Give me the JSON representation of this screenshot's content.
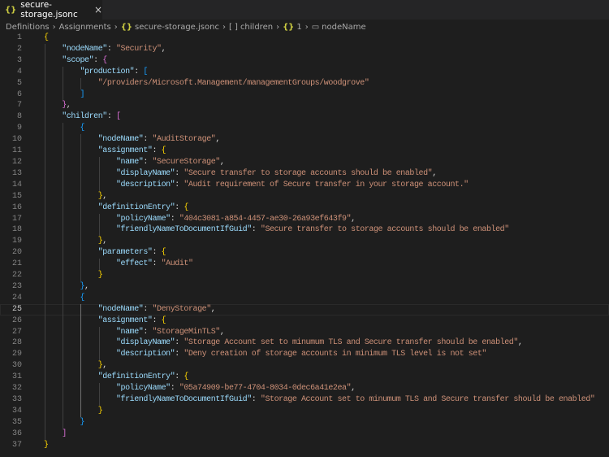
{
  "tab": {
    "icon": "{}",
    "title": "secure-storage.jsonc",
    "close": "×"
  },
  "breadcrumb": [
    {
      "label": "Definitions",
      "icon": ""
    },
    {
      "label": "Assignments",
      "icon": ""
    },
    {
      "label": "secure-storage.jsonc",
      "icon": "{}"
    },
    {
      "label": "children",
      "icon": "[ ]"
    },
    {
      "label": "1",
      "icon": "{}"
    },
    {
      "label": "nodeName",
      "icon": "▭"
    }
  ],
  "editor": {
    "current_line": 25,
    "lines": [
      {
        "n": "1",
        "i": 0,
        "t": [
          [
            "b1",
            "{"
          ]
        ]
      },
      {
        "n": "2",
        "i": 1,
        "t": [
          [
            "k",
            "\"nodeName\""
          ],
          [
            "p",
            ": "
          ],
          [
            "s",
            "\"Security\""
          ],
          [
            "p",
            ","
          ]
        ]
      },
      {
        "n": "3",
        "i": 1,
        "t": [
          [
            "k",
            "\"scope\""
          ],
          [
            "p",
            ": "
          ],
          [
            "b2",
            "{"
          ]
        ]
      },
      {
        "n": "4",
        "i": 2,
        "t": [
          [
            "k",
            "\"production\""
          ],
          [
            "p",
            ": "
          ],
          [
            "b3",
            "["
          ]
        ]
      },
      {
        "n": "5",
        "i": 3,
        "t": [
          [
            "s",
            "\"/providers/Microsoft.Management/managementGroups/woodgrove\""
          ]
        ]
      },
      {
        "n": "6",
        "i": 2,
        "t": [
          [
            "b3",
            "]"
          ]
        ]
      },
      {
        "n": "7",
        "i": 1,
        "t": [
          [
            "b2",
            "}"
          ],
          [
            "p",
            ","
          ]
        ]
      },
      {
        "n": "8",
        "i": 1,
        "t": [
          [
            "k",
            "\"children\""
          ],
          [
            "p",
            ": "
          ],
          [
            "b2",
            "["
          ]
        ]
      },
      {
        "n": "9",
        "i": 2,
        "t": [
          [
            "b3",
            "{"
          ]
        ]
      },
      {
        "n": "10",
        "i": 3,
        "t": [
          [
            "k",
            "\"nodeName\""
          ],
          [
            "p",
            ": "
          ],
          [
            "s",
            "\"AuditStorage\""
          ],
          [
            "p",
            ","
          ]
        ]
      },
      {
        "n": "11",
        "i": 3,
        "t": [
          [
            "k",
            "\"assignment\""
          ],
          [
            "p",
            ": "
          ],
          [
            "b1",
            "{"
          ]
        ]
      },
      {
        "n": "12",
        "i": 4,
        "t": [
          [
            "k",
            "\"name\""
          ],
          [
            "p",
            ": "
          ],
          [
            "s",
            "\"SecureStorage\""
          ],
          [
            "p",
            ","
          ]
        ]
      },
      {
        "n": "13",
        "i": 4,
        "t": [
          [
            "k",
            "\"displayName\""
          ],
          [
            "p",
            ": "
          ],
          [
            "s",
            "\"Secure transfer to storage accounts should be enabled\""
          ],
          [
            "p",
            ","
          ]
        ]
      },
      {
        "n": "14",
        "i": 4,
        "t": [
          [
            "k",
            "\"description\""
          ],
          [
            "p",
            ": "
          ],
          [
            "s",
            "\"Audit requirement of Secure transfer in your storage account.\""
          ]
        ]
      },
      {
        "n": "15",
        "i": 3,
        "t": [
          [
            "b1",
            "}"
          ],
          [
            "p",
            ","
          ]
        ]
      },
      {
        "n": "16",
        "i": 3,
        "t": [
          [
            "k",
            "\"definitionEntry\""
          ],
          [
            "p",
            ": "
          ],
          [
            "b1",
            "{"
          ]
        ]
      },
      {
        "n": "17",
        "i": 4,
        "t": [
          [
            "k",
            "\"policyName\""
          ],
          [
            "p",
            ": "
          ],
          [
            "s",
            "\"404c3081-a854-4457-ae30-26a93ef643f9\""
          ],
          [
            "p",
            ","
          ]
        ]
      },
      {
        "n": "18",
        "i": 4,
        "t": [
          [
            "k",
            "\"friendlyNameToDocumentIfGuid\""
          ],
          [
            "p",
            ": "
          ],
          [
            "s",
            "\"Secure transfer to storage accounts should be enabled\""
          ]
        ]
      },
      {
        "n": "19",
        "i": 3,
        "t": [
          [
            "b1",
            "}"
          ],
          [
            "p",
            ","
          ]
        ]
      },
      {
        "n": "20",
        "i": 3,
        "t": [
          [
            "k",
            "\"parameters\""
          ],
          [
            "p",
            ": "
          ],
          [
            "b1",
            "{"
          ]
        ]
      },
      {
        "n": "21",
        "i": 4,
        "t": [
          [
            "k",
            "\"effect\""
          ],
          [
            "p",
            ": "
          ],
          [
            "s",
            "\"Audit\""
          ]
        ]
      },
      {
        "n": "22",
        "i": 3,
        "t": [
          [
            "b1",
            "}"
          ]
        ]
      },
      {
        "n": "23",
        "i": 2,
        "t": [
          [
            "b3",
            "}"
          ],
          [
            "p",
            ","
          ]
        ]
      },
      {
        "n": "24",
        "i": 2,
        "t": [
          [
            "b3",
            "{"
          ]
        ]
      },
      {
        "n": "25",
        "i": 3,
        "t": [
          [
            "k",
            "\"nodeName\""
          ],
          [
            "p",
            ": "
          ],
          [
            "s",
            "\"DenyStorage\""
          ],
          [
            "p",
            ","
          ]
        ]
      },
      {
        "n": "26",
        "i": 3,
        "t": [
          [
            "k",
            "\"assignment\""
          ],
          [
            "p",
            ": "
          ],
          [
            "b1",
            "{"
          ]
        ]
      },
      {
        "n": "27",
        "i": 4,
        "t": [
          [
            "k",
            "\"name\""
          ],
          [
            "p",
            ": "
          ],
          [
            "s",
            "\"StorageMinTLS\""
          ],
          [
            "p",
            ","
          ]
        ]
      },
      {
        "n": "28",
        "i": 4,
        "t": [
          [
            "k",
            "\"displayName\""
          ],
          [
            "p",
            ": "
          ],
          [
            "s",
            "\"Storage Account set to minumum TLS and Secure transfer should be enabled\""
          ],
          [
            "p",
            ","
          ]
        ]
      },
      {
        "n": "29",
        "i": 4,
        "t": [
          [
            "k",
            "\"description\""
          ],
          [
            "p",
            ": "
          ],
          [
            "s",
            "\"Deny creation of storage accounts in minimum TLS level is not set\""
          ]
        ]
      },
      {
        "n": "30",
        "i": 3,
        "t": [
          [
            "b1",
            "}"
          ],
          [
            "p",
            ","
          ]
        ]
      },
      {
        "n": "31",
        "i": 3,
        "t": [
          [
            "k",
            "\"definitionEntry\""
          ],
          [
            "p",
            ": "
          ],
          [
            "b1",
            "{"
          ]
        ]
      },
      {
        "n": "32",
        "i": 4,
        "t": [
          [
            "k",
            "\"policyName\""
          ],
          [
            "p",
            ": "
          ],
          [
            "s",
            "\"05a74909-be77-4704-8034-0dec6a41e2ea\""
          ],
          [
            "p",
            ","
          ]
        ]
      },
      {
        "n": "33",
        "i": 4,
        "t": [
          [
            "k",
            "\"friendlyNameToDocumentIfGuid\""
          ],
          [
            "p",
            ": "
          ],
          [
            "s",
            "\"Storage Account set to minumum TLS and Secure transfer should be enabled\""
          ]
        ]
      },
      {
        "n": "34",
        "i": 3,
        "t": [
          [
            "b1",
            "}"
          ]
        ]
      },
      {
        "n": "35",
        "i": 2,
        "t": [
          [
            "b3",
            "}"
          ]
        ]
      },
      {
        "n": "36",
        "i": 1,
        "t": [
          [
            "b2",
            "]"
          ]
        ]
      },
      {
        "n": "37",
        "i": 0,
        "t": [
          [
            "b1",
            "}"
          ]
        ]
      }
    ]
  }
}
